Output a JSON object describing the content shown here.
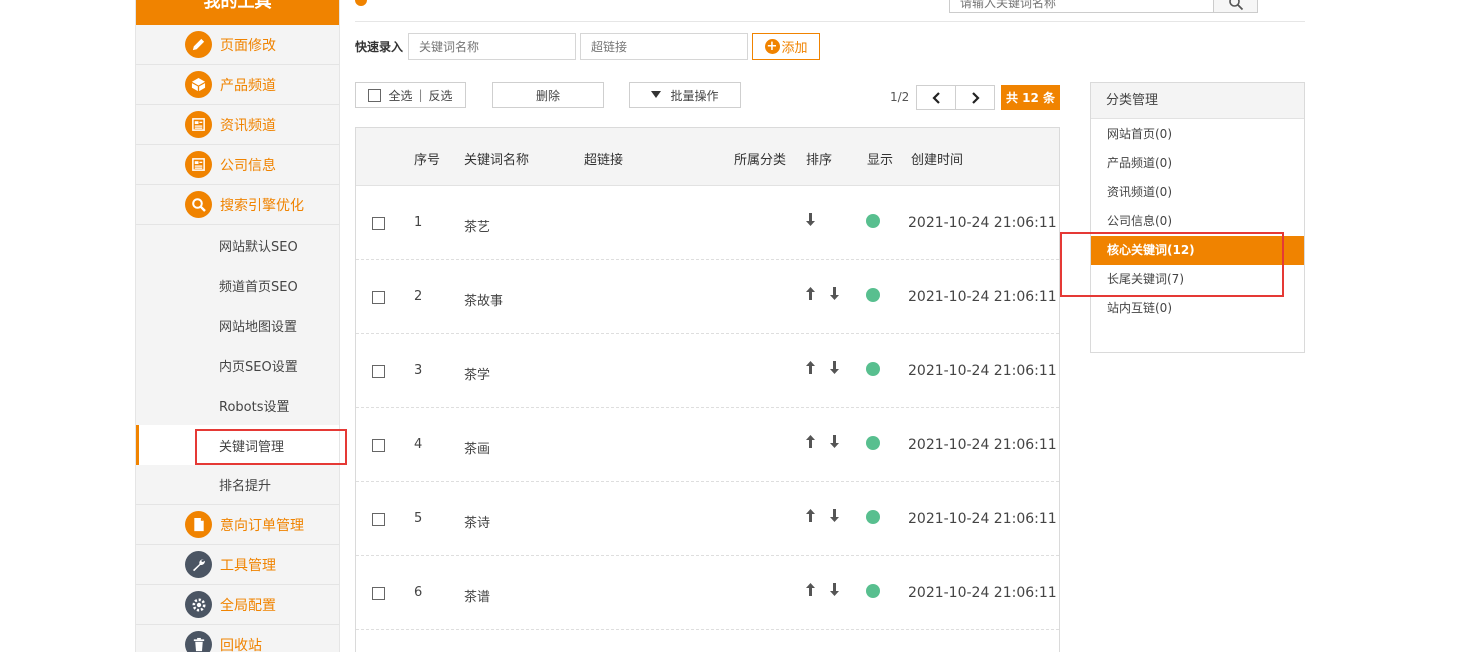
{
  "sidebar": {
    "title": "我的工具",
    "items": [
      {
        "label": "页面修改",
        "icon": "pencil-icon"
      },
      {
        "label": "产品频道",
        "icon": "box-icon"
      },
      {
        "label": "资讯频道",
        "icon": "newspaper-icon"
      },
      {
        "label": "公司信息",
        "icon": "newspaper-icon"
      },
      {
        "label": "搜索引擎优化",
        "icon": "search-icon"
      }
    ],
    "seo_subitems": [
      "网站默认SEO",
      "频道首页SEO",
      "网站地图设置",
      "内页SEO设置",
      "Robots设置",
      "关键词管理",
      "排名提升"
    ],
    "bottom_items": [
      {
        "label": "意向订单管理",
        "icon": "document-icon"
      },
      {
        "label": "工具管理",
        "icon": "wrench-icon"
      },
      {
        "label": "全局配置",
        "icon": "gear-icon"
      },
      {
        "label": "回收站",
        "icon": "trash-icon"
      }
    ]
  },
  "top": {
    "search_placeholder": "请输入关键词名称"
  },
  "quick_entry": {
    "label": "快速录入",
    "name_placeholder": "关键词名称",
    "link_placeholder": "超链接",
    "add_label": "添加"
  },
  "toolbar": {
    "select_all": "全选",
    "separator": "|",
    "invert": "反选",
    "delete": "删除",
    "batch": "批量操作",
    "page": "1/2",
    "total": "共 12 条"
  },
  "table": {
    "headers": {
      "index": "序号",
      "name": "关键词名称",
      "link": "超链接",
      "category": "所属分类",
      "sort": "排序",
      "show": "显示",
      "created": "创建时间"
    },
    "rows": [
      {
        "index": "1",
        "name": "茶艺",
        "created": "2021-10-24 21:06:11",
        "has_up": false
      },
      {
        "index": "2",
        "name": "茶故事",
        "created": "2021-10-24 21:06:11",
        "has_up": true
      },
      {
        "index": "3",
        "name": "茶学",
        "created": "2021-10-24 21:06:11",
        "has_up": true
      },
      {
        "index": "4",
        "name": "茶画",
        "created": "2021-10-24 21:06:11",
        "has_up": true
      },
      {
        "index": "5",
        "name": "茶诗",
        "created": "2021-10-24 21:06:11",
        "has_up": true
      },
      {
        "index": "6",
        "name": "茶谱",
        "created": "2021-10-24 21:06:11",
        "has_up": true
      }
    ]
  },
  "categories": {
    "title": "分类管理",
    "items": [
      "网站首页(0)",
      "产品频道(0)",
      "资讯频道(0)",
      "公司信息(0)",
      "核心关键词(12)",
      "长尾关键词(7)",
      "站内互链(0)"
    ],
    "active_index": 4
  },
  "colors": {
    "accent": "#f08300",
    "status_on": "#58bf8f",
    "highlight": "#e53935"
  }
}
